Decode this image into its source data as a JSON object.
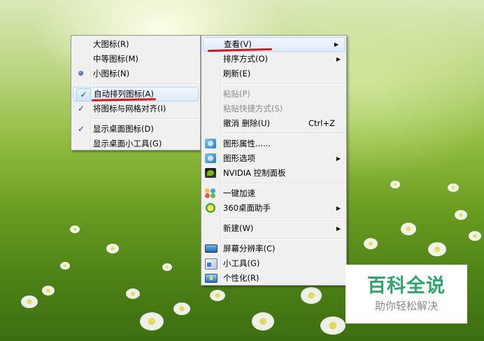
{
  "view_submenu": {
    "items": [
      {
        "label": "大图标(R)",
        "checked": false,
        "radio": false
      },
      {
        "label": "中等图标(M)",
        "checked": false,
        "radio": false
      },
      {
        "label": "小图标(N)",
        "checked": false,
        "radio": true
      },
      {
        "label": "自动排列图标(A)",
        "checked": true,
        "radio": false
      },
      {
        "label": "将图标与网格对齐(I)",
        "checked": true,
        "radio": false
      },
      {
        "label": "显示桌面图标(D)",
        "checked": true,
        "radio": false
      },
      {
        "label": "显示桌面小工具(G)",
        "checked": false,
        "radio": false
      }
    ]
  },
  "context_menu": {
    "view": "查看(V)",
    "sort_by": "排序方式(O)",
    "refresh": "刷新(E)",
    "paste": "粘贴(P)",
    "paste_shortcut": "粘贴快捷方式(S)",
    "undo_delete": "撤消 删除(U)",
    "undo_shortcut": "Ctrl+Z",
    "graphics_properties": "图形属性......",
    "graphics_options": "图形选项",
    "nvidia_panel": "NVIDIA 控制面板",
    "one_click_speedup": "一键加速",
    "desktop_helper_360": "360桌面助手",
    "new": "新建(W)",
    "screen_resolution": "屏幕分辨率(C)",
    "gadgets": "小工具(G)",
    "personalize": "个性化(R)"
  },
  "watermark": {
    "title": "百科全说",
    "subtitle": "助你轻松解决"
  },
  "colors": {
    "menu_bg": "#f0f0f0",
    "highlight_border": "#b8d6fb",
    "annotation_red": "#d7191c",
    "watermark_green": "#2fa56d"
  }
}
